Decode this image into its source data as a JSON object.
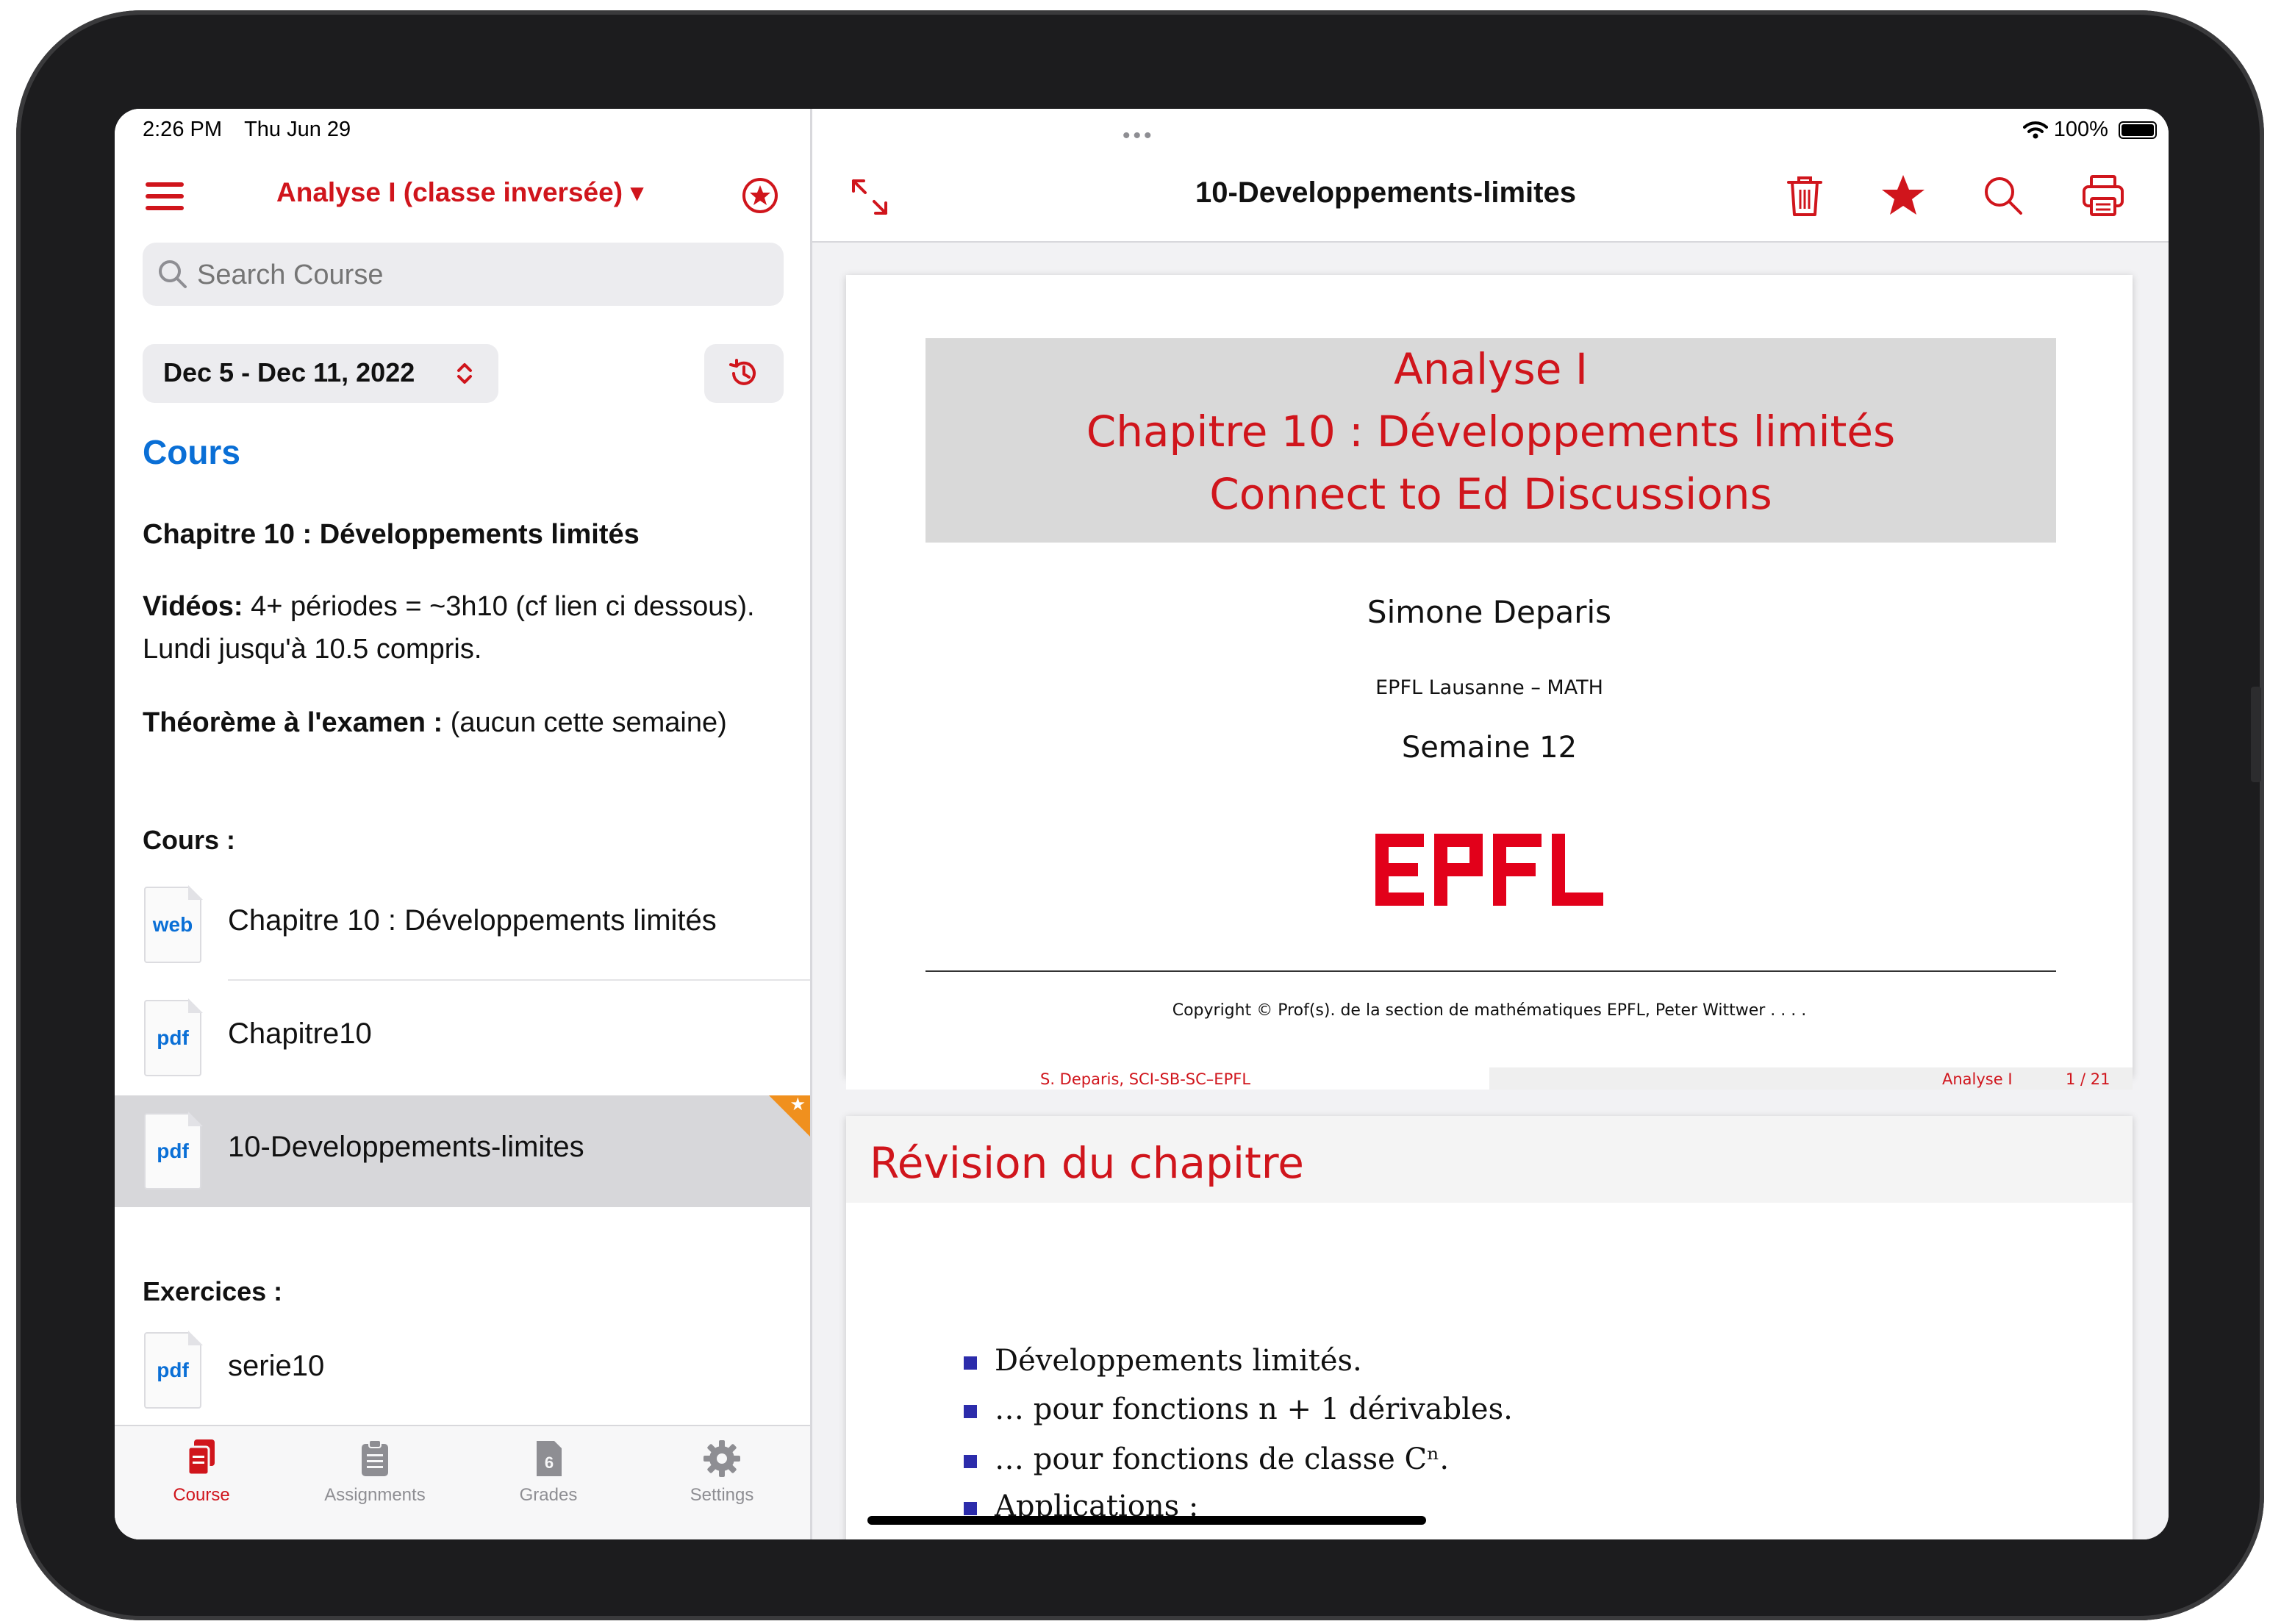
{
  "status_bar": {
    "time": "2:26 PM",
    "date": "Thu Jun 29",
    "battery": "100%"
  },
  "sidebar": {
    "course_title": "Analyse I (classe inversée) ▾",
    "search_placeholder": "Search Course",
    "date_range": "Dec 5 - Dec 11, 2022",
    "section_title": "Cours",
    "chapter_heading": "Chapitre 10 : Développements limités",
    "videos_label": "Vidéos:",
    "videos_text": " 4+ périodes = ~3h10  (cf lien ci dessous). Lundi jusqu'à 10.5 compris.",
    "theorem_label": "Théorème à l'examen :",
    "theorem_text": " (aucun cette semaine)",
    "cours_label": "Cours :",
    "cours_items": [
      {
        "type": "web",
        "name": "Chapitre 10 : Développements limités"
      },
      {
        "type": "pdf",
        "name": "Chapitre10"
      },
      {
        "type": "pdf",
        "name": "10-Developpements-limites",
        "selected": true,
        "favorite": true
      }
    ],
    "exercices_label": "Exercices :",
    "exercice_items": [
      {
        "type": "pdf",
        "name": "serie10"
      }
    ]
  },
  "tabbar": {
    "tabs": [
      {
        "label": "Course",
        "active": true
      },
      {
        "label": "Assignments",
        "active": false
      },
      {
        "label": "Grades",
        "badge": "6",
        "active": false
      },
      {
        "label": "Settings",
        "active": false
      }
    ]
  },
  "document": {
    "title": "10-Developpements-limites",
    "slide1": {
      "title_lines": [
        "Analyse I",
        "Chapitre 10 : Développements limités",
        "Connect to Ed Discussions"
      ],
      "author": "Simone Deparis",
      "affiliation": "EPFL Lausanne – MATH",
      "week": "Semaine 12",
      "logo_text": "EPFL",
      "copyright": "Copyright © Prof(s). de la section de mathématiques EPFL, Peter Wittwer . . . .",
      "footer_left": "S. Deparis,  SCI-SB-SC–EPFL",
      "footer_course": "Analyse I",
      "footer_page": "1 / 21"
    },
    "slide2": {
      "title": "Révision du chapitre",
      "bullets": [
        "Développements limités.",
        "… pour fonctions n + 1 dérivables.",
        "… pour fonctions de classe Cⁿ.",
        "Applications :"
      ]
    }
  },
  "colors": {
    "accent": "#d0151c",
    "link_blue": "#0a6fd6",
    "selection": "#d7d7da",
    "favorite": "#f0901e"
  }
}
